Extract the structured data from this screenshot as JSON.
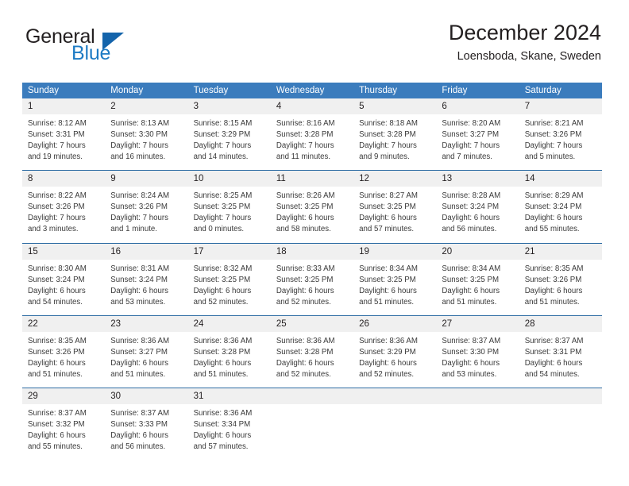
{
  "brand": {
    "name_part1": "General",
    "name_part2": "Blue",
    "triangle_color": "#1464ab",
    "blue_color": "#1e7bc4"
  },
  "header": {
    "title": "December 2024",
    "subtitle": "Loensboda, Skane, Sweden"
  },
  "theme": {
    "header_blue": "#3b7cbd",
    "row_divider_blue": "#2e6da4",
    "daynum_bg": "#f0f0f0"
  },
  "weekday_headers": [
    "Sunday",
    "Monday",
    "Tuesday",
    "Wednesday",
    "Thursday",
    "Friday",
    "Saturday"
  ],
  "weeks": [
    [
      {
        "day": "1",
        "sunrise": "Sunrise: 8:12 AM",
        "sunset": "Sunset: 3:31 PM",
        "daylight1": "Daylight: 7 hours",
        "daylight2": "and 19 minutes."
      },
      {
        "day": "2",
        "sunrise": "Sunrise: 8:13 AM",
        "sunset": "Sunset: 3:30 PM",
        "daylight1": "Daylight: 7 hours",
        "daylight2": "and 16 minutes."
      },
      {
        "day": "3",
        "sunrise": "Sunrise: 8:15 AM",
        "sunset": "Sunset: 3:29 PM",
        "daylight1": "Daylight: 7 hours",
        "daylight2": "and 14 minutes."
      },
      {
        "day": "4",
        "sunrise": "Sunrise: 8:16 AM",
        "sunset": "Sunset: 3:28 PM",
        "daylight1": "Daylight: 7 hours",
        "daylight2": "and 11 minutes."
      },
      {
        "day": "5",
        "sunrise": "Sunrise: 8:18 AM",
        "sunset": "Sunset: 3:28 PM",
        "daylight1": "Daylight: 7 hours",
        "daylight2": "and 9 minutes."
      },
      {
        "day": "6",
        "sunrise": "Sunrise: 8:20 AM",
        "sunset": "Sunset: 3:27 PM",
        "daylight1": "Daylight: 7 hours",
        "daylight2": "and 7 minutes."
      },
      {
        "day": "7",
        "sunrise": "Sunrise: 8:21 AM",
        "sunset": "Sunset: 3:26 PM",
        "daylight1": "Daylight: 7 hours",
        "daylight2": "and 5 minutes."
      }
    ],
    [
      {
        "day": "8",
        "sunrise": "Sunrise: 8:22 AM",
        "sunset": "Sunset: 3:26 PM",
        "daylight1": "Daylight: 7 hours",
        "daylight2": "and 3 minutes."
      },
      {
        "day": "9",
        "sunrise": "Sunrise: 8:24 AM",
        "sunset": "Sunset: 3:26 PM",
        "daylight1": "Daylight: 7 hours",
        "daylight2": "and 1 minute."
      },
      {
        "day": "10",
        "sunrise": "Sunrise: 8:25 AM",
        "sunset": "Sunset: 3:25 PM",
        "daylight1": "Daylight: 7 hours",
        "daylight2": "and 0 minutes."
      },
      {
        "day": "11",
        "sunrise": "Sunrise: 8:26 AM",
        "sunset": "Sunset: 3:25 PM",
        "daylight1": "Daylight: 6 hours",
        "daylight2": "and 58 minutes."
      },
      {
        "day": "12",
        "sunrise": "Sunrise: 8:27 AM",
        "sunset": "Sunset: 3:25 PM",
        "daylight1": "Daylight: 6 hours",
        "daylight2": "and 57 minutes."
      },
      {
        "day": "13",
        "sunrise": "Sunrise: 8:28 AM",
        "sunset": "Sunset: 3:24 PM",
        "daylight1": "Daylight: 6 hours",
        "daylight2": "and 56 minutes."
      },
      {
        "day": "14",
        "sunrise": "Sunrise: 8:29 AM",
        "sunset": "Sunset: 3:24 PM",
        "daylight1": "Daylight: 6 hours",
        "daylight2": "and 55 minutes."
      }
    ],
    [
      {
        "day": "15",
        "sunrise": "Sunrise: 8:30 AM",
        "sunset": "Sunset: 3:24 PM",
        "daylight1": "Daylight: 6 hours",
        "daylight2": "and 54 minutes."
      },
      {
        "day": "16",
        "sunrise": "Sunrise: 8:31 AM",
        "sunset": "Sunset: 3:24 PM",
        "daylight1": "Daylight: 6 hours",
        "daylight2": "and 53 minutes."
      },
      {
        "day": "17",
        "sunrise": "Sunrise: 8:32 AM",
        "sunset": "Sunset: 3:25 PM",
        "daylight1": "Daylight: 6 hours",
        "daylight2": "and 52 minutes."
      },
      {
        "day": "18",
        "sunrise": "Sunrise: 8:33 AM",
        "sunset": "Sunset: 3:25 PM",
        "daylight1": "Daylight: 6 hours",
        "daylight2": "and 52 minutes."
      },
      {
        "day": "19",
        "sunrise": "Sunrise: 8:34 AM",
        "sunset": "Sunset: 3:25 PM",
        "daylight1": "Daylight: 6 hours",
        "daylight2": "and 51 minutes."
      },
      {
        "day": "20",
        "sunrise": "Sunrise: 8:34 AM",
        "sunset": "Sunset: 3:25 PM",
        "daylight1": "Daylight: 6 hours",
        "daylight2": "and 51 minutes."
      },
      {
        "day": "21",
        "sunrise": "Sunrise: 8:35 AM",
        "sunset": "Sunset: 3:26 PM",
        "daylight1": "Daylight: 6 hours",
        "daylight2": "and 51 minutes."
      }
    ],
    [
      {
        "day": "22",
        "sunrise": "Sunrise: 8:35 AM",
        "sunset": "Sunset: 3:26 PM",
        "daylight1": "Daylight: 6 hours",
        "daylight2": "and 51 minutes."
      },
      {
        "day": "23",
        "sunrise": "Sunrise: 8:36 AM",
        "sunset": "Sunset: 3:27 PM",
        "daylight1": "Daylight: 6 hours",
        "daylight2": "and 51 minutes."
      },
      {
        "day": "24",
        "sunrise": "Sunrise: 8:36 AM",
        "sunset": "Sunset: 3:28 PM",
        "daylight1": "Daylight: 6 hours",
        "daylight2": "and 51 minutes."
      },
      {
        "day": "25",
        "sunrise": "Sunrise: 8:36 AM",
        "sunset": "Sunset: 3:28 PM",
        "daylight1": "Daylight: 6 hours",
        "daylight2": "and 52 minutes."
      },
      {
        "day": "26",
        "sunrise": "Sunrise: 8:36 AM",
        "sunset": "Sunset: 3:29 PM",
        "daylight1": "Daylight: 6 hours",
        "daylight2": "and 52 minutes."
      },
      {
        "day": "27",
        "sunrise": "Sunrise: 8:37 AM",
        "sunset": "Sunset: 3:30 PM",
        "daylight1": "Daylight: 6 hours",
        "daylight2": "and 53 minutes."
      },
      {
        "day": "28",
        "sunrise": "Sunrise: 8:37 AM",
        "sunset": "Sunset: 3:31 PM",
        "daylight1": "Daylight: 6 hours",
        "daylight2": "and 54 minutes."
      }
    ],
    [
      {
        "day": "29",
        "sunrise": "Sunrise: 8:37 AM",
        "sunset": "Sunset: 3:32 PM",
        "daylight1": "Daylight: 6 hours",
        "daylight2": "and 55 minutes."
      },
      {
        "day": "30",
        "sunrise": "Sunrise: 8:37 AM",
        "sunset": "Sunset: 3:33 PM",
        "daylight1": "Daylight: 6 hours",
        "daylight2": "and 56 minutes."
      },
      {
        "day": "31",
        "sunrise": "Sunrise: 8:36 AM",
        "sunset": "Sunset: 3:34 PM",
        "daylight1": "Daylight: 6 hours",
        "daylight2": "and 57 minutes."
      },
      {
        "day": "",
        "sunrise": "",
        "sunset": "",
        "daylight1": "",
        "daylight2": ""
      },
      {
        "day": "",
        "sunrise": "",
        "sunset": "",
        "daylight1": "",
        "daylight2": ""
      },
      {
        "day": "",
        "sunrise": "",
        "sunset": "",
        "daylight1": "",
        "daylight2": ""
      },
      {
        "day": "",
        "sunrise": "",
        "sunset": "",
        "daylight1": "",
        "daylight2": ""
      }
    ]
  ]
}
